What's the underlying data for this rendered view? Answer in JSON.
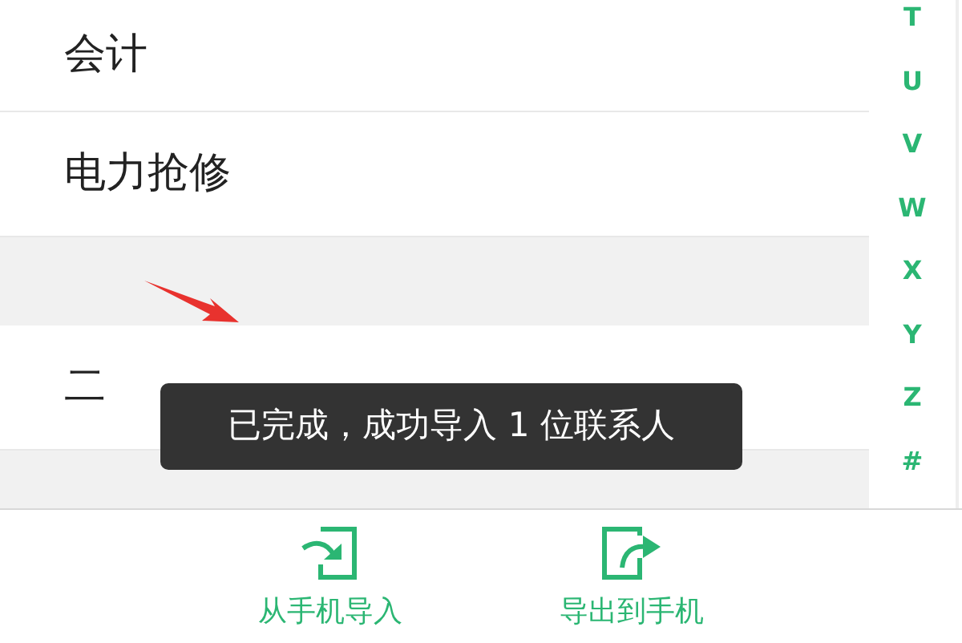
{
  "contacts": [
    {
      "kind": "contact",
      "name": "会计"
    },
    {
      "kind": "contact",
      "name": "电力抢修"
    },
    {
      "kind": "section"
    },
    {
      "kind": "contact",
      "name": "二"
    },
    {
      "kind": "section"
    }
  ],
  "index_letters": [
    "T",
    "U",
    "V",
    "W",
    "X",
    "Y",
    "Z",
    "#"
  ],
  "toast": "已完成，成功导入 1 位联系人",
  "actions": [
    {
      "kind": "import",
      "label": "从手机导入"
    },
    {
      "kind": "export",
      "label": "导出到手机"
    }
  ]
}
